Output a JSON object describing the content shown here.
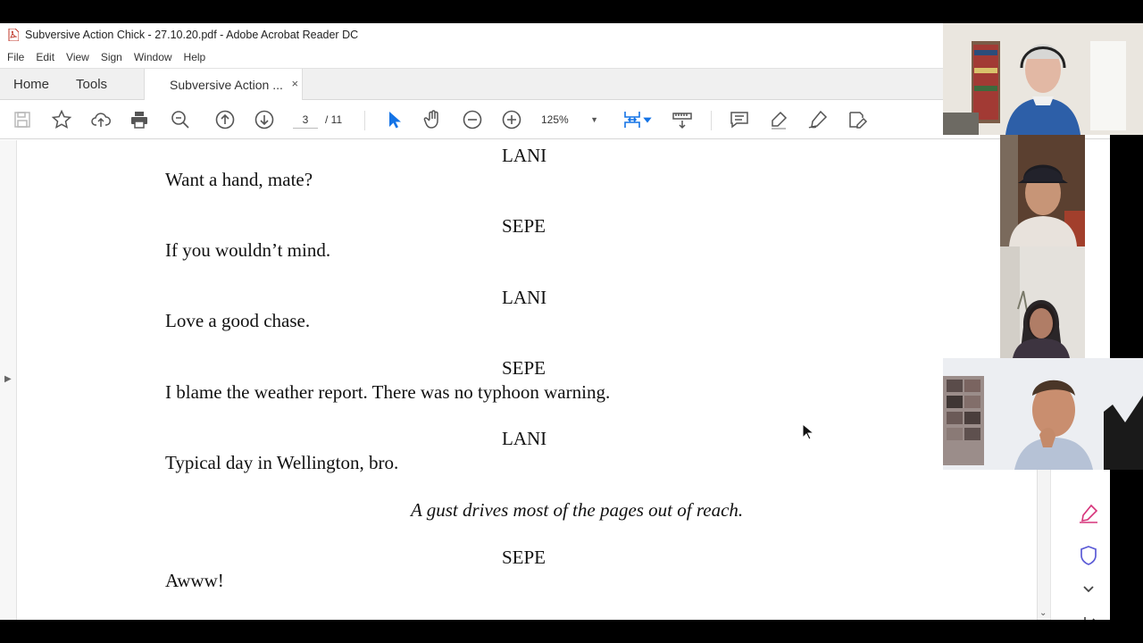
{
  "window": {
    "title": "Subversive Action Chick - 27.10.20.pdf - Adobe Acrobat Reader DC"
  },
  "menu": [
    "File",
    "Edit",
    "View",
    "Sign",
    "Window",
    "Help"
  ],
  "tabs": {
    "home": "Home",
    "tools": "Tools",
    "document": "Subversive Action ...",
    "close": "×"
  },
  "toolbar": {
    "current_page": "3",
    "total_pages": "/  11",
    "zoom": "125%"
  },
  "document": {
    "lines": [
      {
        "kind": "char",
        "text": "LANI"
      },
      {
        "kind": "line",
        "text": "Want a hand, mate?"
      },
      {
        "kind": "char",
        "text": "SEPE"
      },
      {
        "kind": "line",
        "text": "If you wouldn’t mind."
      },
      {
        "kind": "char",
        "text": "LANI"
      },
      {
        "kind": "line",
        "text": "Love a good chase."
      },
      {
        "kind": "char",
        "text": "SEPE"
      },
      {
        "kind": "line",
        "text": "I blame the weather report. There was no typhoon warning."
      },
      {
        "kind": "char",
        "text": "LANI"
      },
      {
        "kind": "line",
        "text": "Typical day in Wellington, bro."
      },
      {
        "kind": "direction",
        "text": "A gust drives most of the pages out of reach."
      },
      {
        "kind": "char",
        "text": "SEPE"
      },
      {
        "kind": "line",
        "text": "Awww!"
      }
    ]
  },
  "colors": {
    "accent": "#1473e6",
    "pen": "#d6337a",
    "shield": "#5b5bd6"
  }
}
